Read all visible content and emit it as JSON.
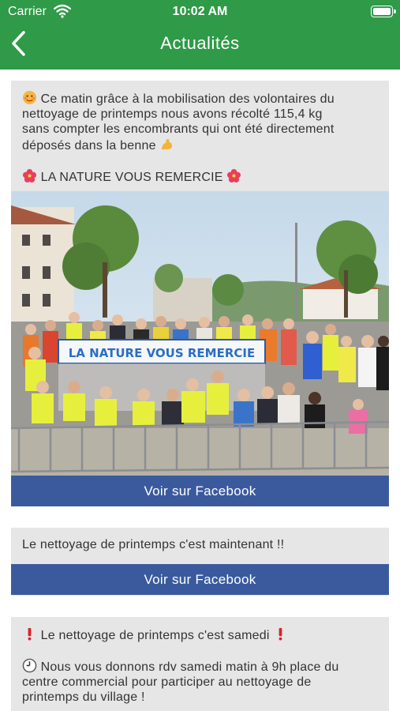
{
  "status_bar": {
    "carrier": "Carrier",
    "time": "10:02 AM"
  },
  "nav": {
    "title": "Actualités"
  },
  "posts": [
    {
      "line1": "Ce matin grâce à la mobilisation des volontaires du",
      "line2": "nettoyage de printemps nous avons récolté 115,4 kg",
      "line3": "sans compter les encombrants qui ont été directement",
      "line4": "déposés dans la benne",
      "line5": "LA NATURE VOUS REMERCIE",
      "banner_text": "LA NATURE VOUS REMERCIE",
      "button": "Voir sur Facebook"
    },
    {
      "line1": "Le nettoyage de printemps c'est maintenant !!",
      "button": "Voir sur Facebook"
    },
    {
      "line1": "Le nettoyage de printemps c'est samedi",
      "line2": "Nous vous donnons rdv samedi matin à 9h place du",
      "line3": "centre commercial pour participer au nettoyage de",
      "line4": "printemps du village !"
    }
  ],
  "colors": {
    "header": "#2f9a47",
    "facebook": "#3b5a9e",
    "card": "#e6e6e6"
  }
}
